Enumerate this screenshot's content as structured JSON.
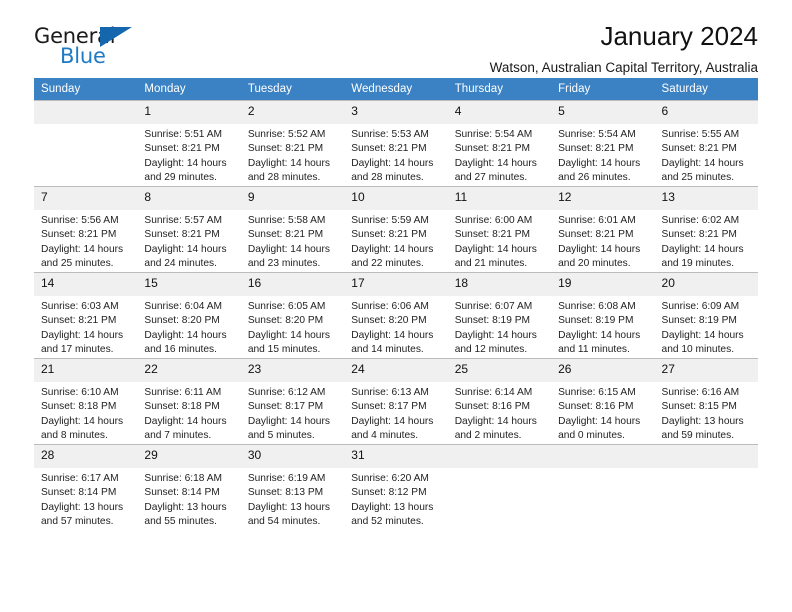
{
  "brand": {
    "name_top": "General",
    "name_bottom": "Blue",
    "accent_color": "#1f7ac4",
    "triangle_color": "#1466ad"
  },
  "header": {
    "title": "January 2024",
    "subtitle": "Watson, Australian Capital Territory, Australia"
  },
  "calendar": {
    "header_background": "#3b82c4",
    "daynum_background": "#f0f0f0",
    "weekday_labels": [
      "Sunday",
      "Monday",
      "Tuesday",
      "Wednesday",
      "Thursday",
      "Friday",
      "Saturday"
    ],
    "labels": {
      "sunrise": "Sunrise:",
      "sunset": "Sunset:",
      "daylight": "Daylight:"
    },
    "weeks": [
      [
        {
          "day": "",
          "empty": true
        },
        {
          "day": "1",
          "sunrise": "Sunrise: 5:51 AM",
          "sunset": "Sunset: 8:21 PM",
          "daylight_1": "Daylight: 14 hours",
          "daylight_2": "and 29 minutes."
        },
        {
          "day": "2",
          "sunrise": "Sunrise: 5:52 AM",
          "sunset": "Sunset: 8:21 PM",
          "daylight_1": "Daylight: 14 hours",
          "daylight_2": "and 28 minutes."
        },
        {
          "day": "3",
          "sunrise": "Sunrise: 5:53 AM",
          "sunset": "Sunset: 8:21 PM",
          "daylight_1": "Daylight: 14 hours",
          "daylight_2": "and 28 minutes."
        },
        {
          "day": "4",
          "sunrise": "Sunrise: 5:54 AM",
          "sunset": "Sunset: 8:21 PM",
          "daylight_1": "Daylight: 14 hours",
          "daylight_2": "and 27 minutes."
        },
        {
          "day": "5",
          "sunrise": "Sunrise: 5:54 AM",
          "sunset": "Sunset: 8:21 PM",
          "daylight_1": "Daylight: 14 hours",
          "daylight_2": "and 26 minutes."
        },
        {
          "day": "6",
          "sunrise": "Sunrise: 5:55 AM",
          "sunset": "Sunset: 8:21 PM",
          "daylight_1": "Daylight: 14 hours",
          "daylight_2": "and 25 minutes."
        }
      ],
      [
        {
          "day": "7",
          "sunrise": "Sunrise: 5:56 AM",
          "sunset": "Sunset: 8:21 PM",
          "daylight_1": "Daylight: 14 hours",
          "daylight_2": "and 25 minutes."
        },
        {
          "day": "8",
          "sunrise": "Sunrise: 5:57 AM",
          "sunset": "Sunset: 8:21 PM",
          "daylight_1": "Daylight: 14 hours",
          "daylight_2": "and 24 minutes."
        },
        {
          "day": "9",
          "sunrise": "Sunrise: 5:58 AM",
          "sunset": "Sunset: 8:21 PM",
          "daylight_1": "Daylight: 14 hours",
          "daylight_2": "and 23 minutes."
        },
        {
          "day": "10",
          "sunrise": "Sunrise: 5:59 AM",
          "sunset": "Sunset: 8:21 PM",
          "daylight_1": "Daylight: 14 hours",
          "daylight_2": "and 22 minutes."
        },
        {
          "day": "11",
          "sunrise": "Sunrise: 6:00 AM",
          "sunset": "Sunset: 8:21 PM",
          "daylight_1": "Daylight: 14 hours",
          "daylight_2": "and 21 minutes."
        },
        {
          "day": "12",
          "sunrise": "Sunrise: 6:01 AM",
          "sunset": "Sunset: 8:21 PM",
          "daylight_1": "Daylight: 14 hours",
          "daylight_2": "and 20 minutes."
        },
        {
          "day": "13",
          "sunrise": "Sunrise: 6:02 AM",
          "sunset": "Sunset: 8:21 PM",
          "daylight_1": "Daylight: 14 hours",
          "daylight_2": "and 19 minutes."
        }
      ],
      [
        {
          "day": "14",
          "sunrise": "Sunrise: 6:03 AM",
          "sunset": "Sunset: 8:21 PM",
          "daylight_1": "Daylight: 14 hours",
          "daylight_2": "and 17 minutes."
        },
        {
          "day": "15",
          "sunrise": "Sunrise: 6:04 AM",
          "sunset": "Sunset: 8:20 PM",
          "daylight_1": "Daylight: 14 hours",
          "daylight_2": "and 16 minutes."
        },
        {
          "day": "16",
          "sunrise": "Sunrise: 6:05 AM",
          "sunset": "Sunset: 8:20 PM",
          "daylight_1": "Daylight: 14 hours",
          "daylight_2": "and 15 minutes."
        },
        {
          "day": "17",
          "sunrise": "Sunrise: 6:06 AM",
          "sunset": "Sunset: 8:20 PM",
          "daylight_1": "Daylight: 14 hours",
          "daylight_2": "and 14 minutes."
        },
        {
          "day": "18",
          "sunrise": "Sunrise: 6:07 AM",
          "sunset": "Sunset: 8:19 PM",
          "daylight_1": "Daylight: 14 hours",
          "daylight_2": "and 12 minutes."
        },
        {
          "day": "19",
          "sunrise": "Sunrise: 6:08 AM",
          "sunset": "Sunset: 8:19 PM",
          "daylight_1": "Daylight: 14 hours",
          "daylight_2": "and 11 minutes."
        },
        {
          "day": "20",
          "sunrise": "Sunrise: 6:09 AM",
          "sunset": "Sunset: 8:19 PM",
          "daylight_1": "Daylight: 14 hours",
          "daylight_2": "and 10 minutes."
        }
      ],
      [
        {
          "day": "21",
          "sunrise": "Sunrise: 6:10 AM",
          "sunset": "Sunset: 8:18 PM",
          "daylight_1": "Daylight: 14 hours",
          "daylight_2": "and 8 minutes."
        },
        {
          "day": "22",
          "sunrise": "Sunrise: 6:11 AM",
          "sunset": "Sunset: 8:18 PM",
          "daylight_1": "Daylight: 14 hours",
          "daylight_2": "and 7 minutes."
        },
        {
          "day": "23",
          "sunrise": "Sunrise: 6:12 AM",
          "sunset": "Sunset: 8:17 PM",
          "daylight_1": "Daylight: 14 hours",
          "daylight_2": "and 5 minutes."
        },
        {
          "day": "24",
          "sunrise": "Sunrise: 6:13 AM",
          "sunset": "Sunset: 8:17 PM",
          "daylight_1": "Daylight: 14 hours",
          "daylight_2": "and 4 minutes."
        },
        {
          "day": "25",
          "sunrise": "Sunrise: 6:14 AM",
          "sunset": "Sunset: 8:16 PM",
          "daylight_1": "Daylight: 14 hours",
          "daylight_2": "and 2 minutes."
        },
        {
          "day": "26",
          "sunrise": "Sunrise: 6:15 AM",
          "sunset": "Sunset: 8:16 PM",
          "daylight_1": "Daylight: 14 hours",
          "daylight_2": "and 0 minutes."
        },
        {
          "day": "27",
          "sunrise": "Sunrise: 6:16 AM",
          "sunset": "Sunset: 8:15 PM",
          "daylight_1": "Daylight: 13 hours",
          "daylight_2": "and 59 minutes."
        }
      ],
      [
        {
          "day": "28",
          "sunrise": "Sunrise: 6:17 AM",
          "sunset": "Sunset: 8:14 PM",
          "daylight_1": "Daylight: 13 hours",
          "daylight_2": "and 57 minutes."
        },
        {
          "day": "29",
          "sunrise": "Sunrise: 6:18 AM",
          "sunset": "Sunset: 8:14 PM",
          "daylight_1": "Daylight: 13 hours",
          "daylight_2": "and 55 minutes."
        },
        {
          "day": "30",
          "sunrise": "Sunrise: 6:19 AM",
          "sunset": "Sunset: 8:13 PM",
          "daylight_1": "Daylight: 13 hours",
          "daylight_2": "and 54 minutes."
        },
        {
          "day": "31",
          "sunrise": "Sunrise: 6:20 AM",
          "sunset": "Sunset: 8:12 PM",
          "daylight_1": "Daylight: 13 hours",
          "daylight_2": "and 52 minutes."
        },
        {
          "day": "",
          "empty": true
        },
        {
          "day": "",
          "empty": true
        },
        {
          "day": "",
          "empty": true
        }
      ]
    ]
  }
}
